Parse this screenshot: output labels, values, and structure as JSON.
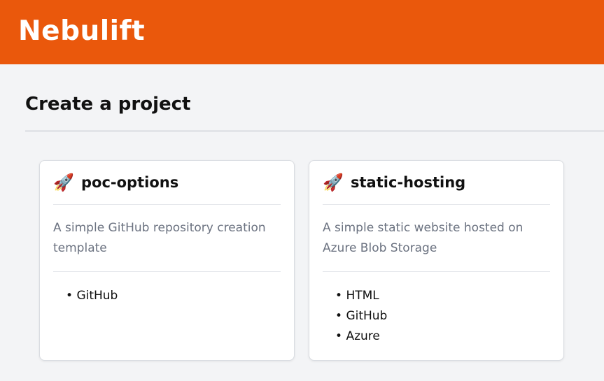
{
  "header": {
    "brand": "Nebulift",
    "accent_color": "#ea580c"
  },
  "page": {
    "title": "Create a project"
  },
  "cards": [
    {
      "icon": "rocket-icon",
      "icon_glyph": "🚀",
      "title": "poc-options",
      "description": "A simple GitHub repository creation template",
      "tags": [
        "GitHub"
      ]
    },
    {
      "icon": "rocket-icon",
      "icon_glyph": "🚀",
      "title": "static-hosting",
      "description": "A simple static website hosted on Azure Blob Storage",
      "tags": [
        "HTML",
        "GitHub",
        "Azure"
      ]
    }
  ]
}
